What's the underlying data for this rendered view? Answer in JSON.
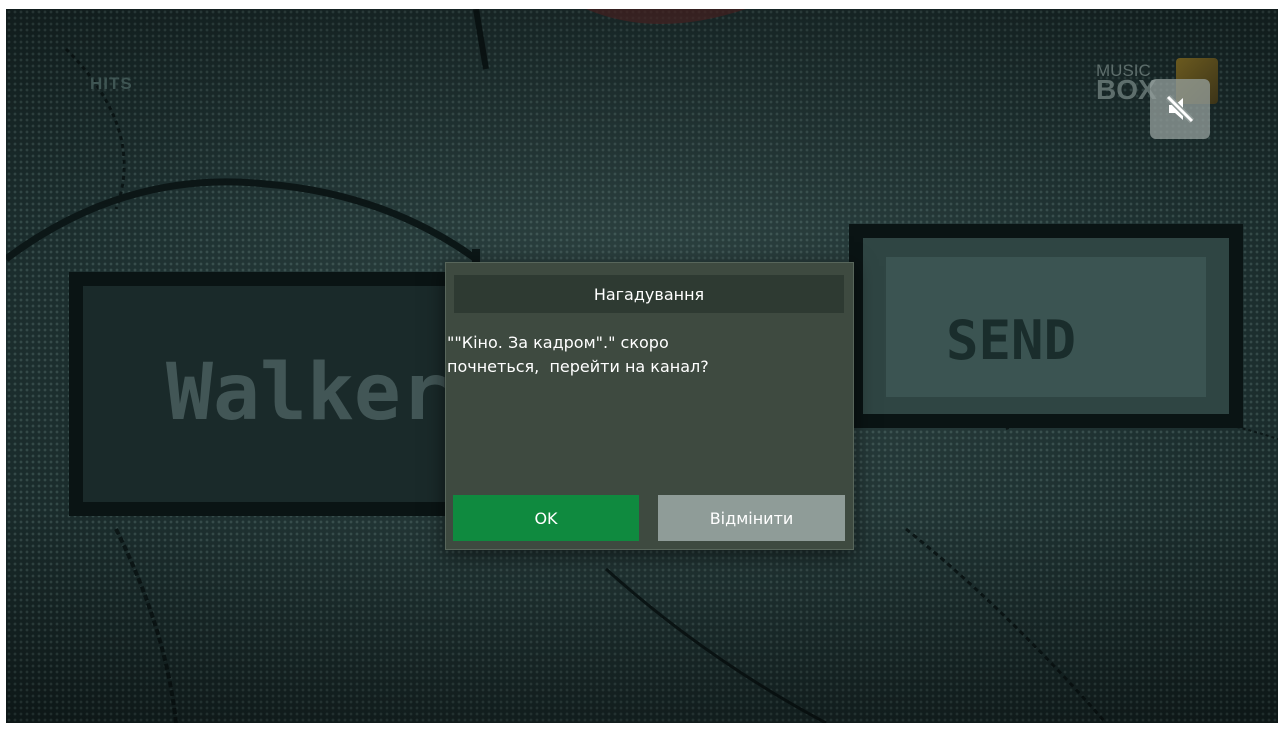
{
  "background": {
    "channel_label": "HITS",
    "logo": {
      "line1": "MUSIC",
      "line2": "BOX"
    },
    "send_text": "SEND",
    "walker_text": "Walker"
  },
  "mute": {
    "icon": "speaker-muted-icon"
  },
  "dialog": {
    "title": "Нагадування",
    "message": "\"\"Кіно. За кадром\".\" скоро\nпочнеться,  перейти на канал?",
    "ok_label": "OK",
    "cancel_label": "Відмінити"
  },
  "colors": {
    "ok_button": "#0f8a3f",
    "cancel_button": "#8f9c98",
    "dialog_bg": "#3e4a40"
  }
}
